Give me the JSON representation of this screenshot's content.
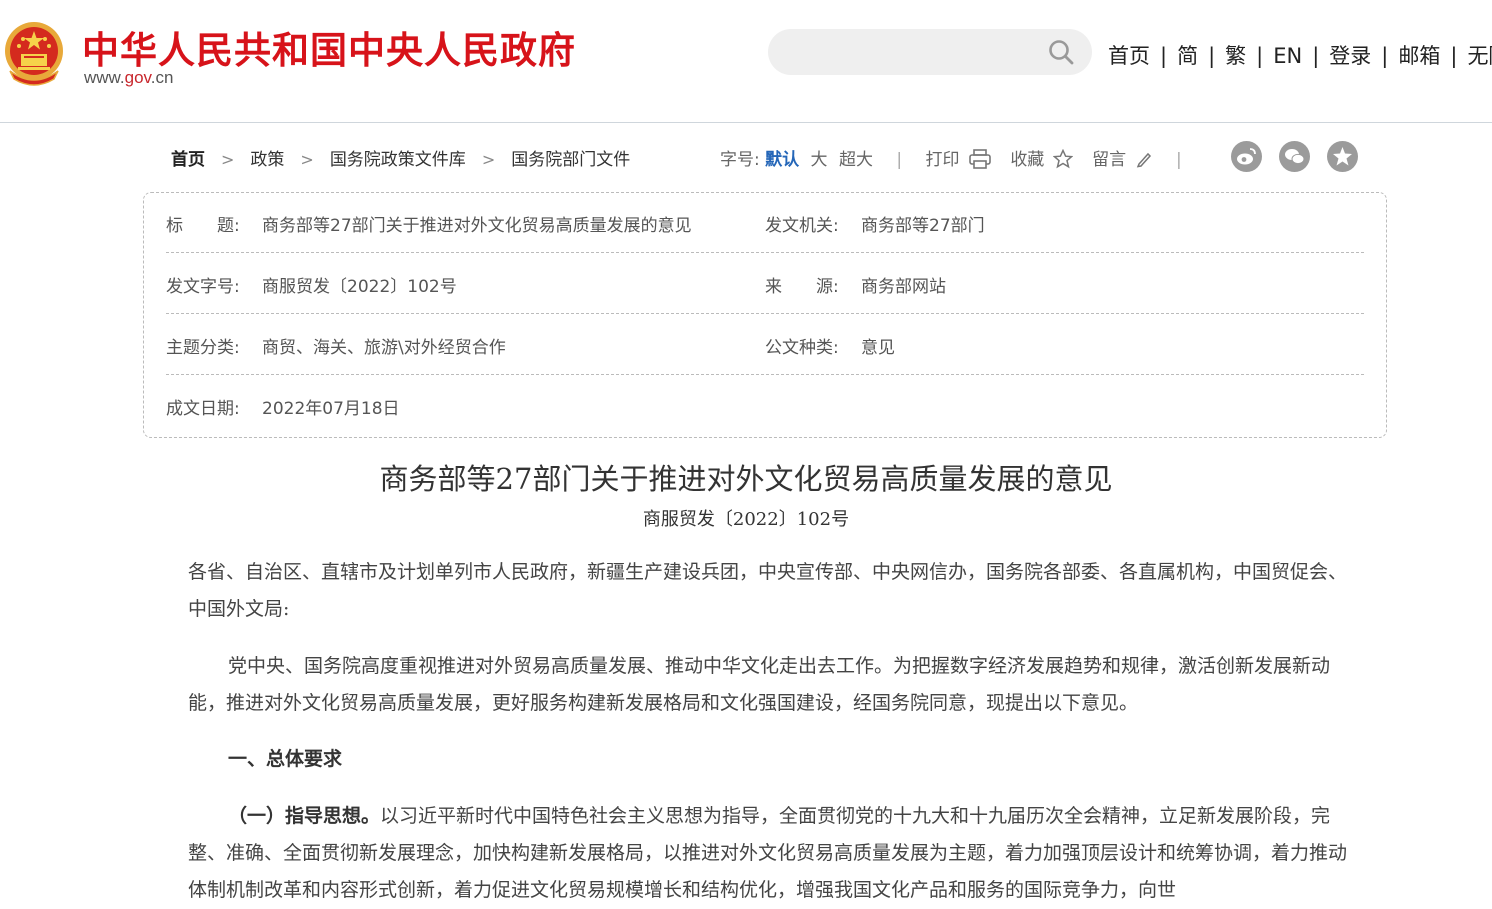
{
  "header": {
    "site_name": "中华人民共和国中央人民政府",
    "site_url_prefix": "www.",
    "site_url_main": "gov",
    "site_url_suffix": ".cn",
    "search_placeholder": "",
    "nav": [
      "首页",
      "简",
      "繁",
      "EN",
      "登录",
      "邮箱",
      "无障"
    ]
  },
  "breadcrumb": [
    "首页",
    "政策",
    "国务院政策文件库",
    "国务院部门文件"
  ],
  "tools": {
    "font_label": "字号:",
    "font_default": "默认",
    "font_large": "大",
    "font_xlarge": "超大",
    "print": "打印",
    "favorite": "收藏",
    "comment": "留言"
  },
  "share_icons": [
    "weibo-icon",
    "wechat-icon",
    "qzone-icon"
  ],
  "info": {
    "title_label": "标　　题:",
    "title_value": "商务部等27部门关于推进对外文化贸易高质量发展的意见",
    "issuer_label": "发文机关:",
    "issuer_value": "商务部等27部门",
    "doc_no_label": "发文字号:",
    "doc_no_value": "商服贸发〔2022〕102号",
    "source_label": "来　　源:",
    "source_value": "商务部网站",
    "topic_label": "主题分类:",
    "topic_value": "商贸、海关、旅游\\对外经贸合作",
    "type_label": "公文种类:",
    "type_value": "意见",
    "date_label": "成文日期:",
    "date_value": "2022年07月18日"
  },
  "article": {
    "title": "商务部等27部门关于推进对外文化贸易高质量发展的意见",
    "doc_number": "商服贸发〔2022〕102号",
    "addressees": "各省、自治区、直辖市及计划单列市人民政府，新疆生产建设兵团，中央宣传部、中央网信办，国务院各部委、各直属机构，中国贸促会、中国外文局:",
    "intro": "党中央、国务院高度重视推进对外贸易高质量发展、推动中华文化走出去工作。为把握数字经济发展趋势和规律，激活创新发展新动能，推进对外文化贸易高质量发展，更好服务构建新发展格局和文化强国建设，经国务院同意，现提出以下意见。",
    "section1": "一、总体要求",
    "sub1_heading": "（一）指导思想。",
    "sub1_text": "以习近平新时代中国特色社会主义思想为指导，全面贯彻党的十九大和十九届历次全会精神，立足新发展阶段，完整、准确、全面贯彻新发展理念，加快构建新发展格局，以推进对外文化贸易高质量发展为主题，着力加强顶层设计和统筹协调，着力推动体制机制改革和内容形式创新，着力促进文化贸易规模增长和结构优化，增强我国文化产品和服务的国际竞争力，向世"
  }
}
